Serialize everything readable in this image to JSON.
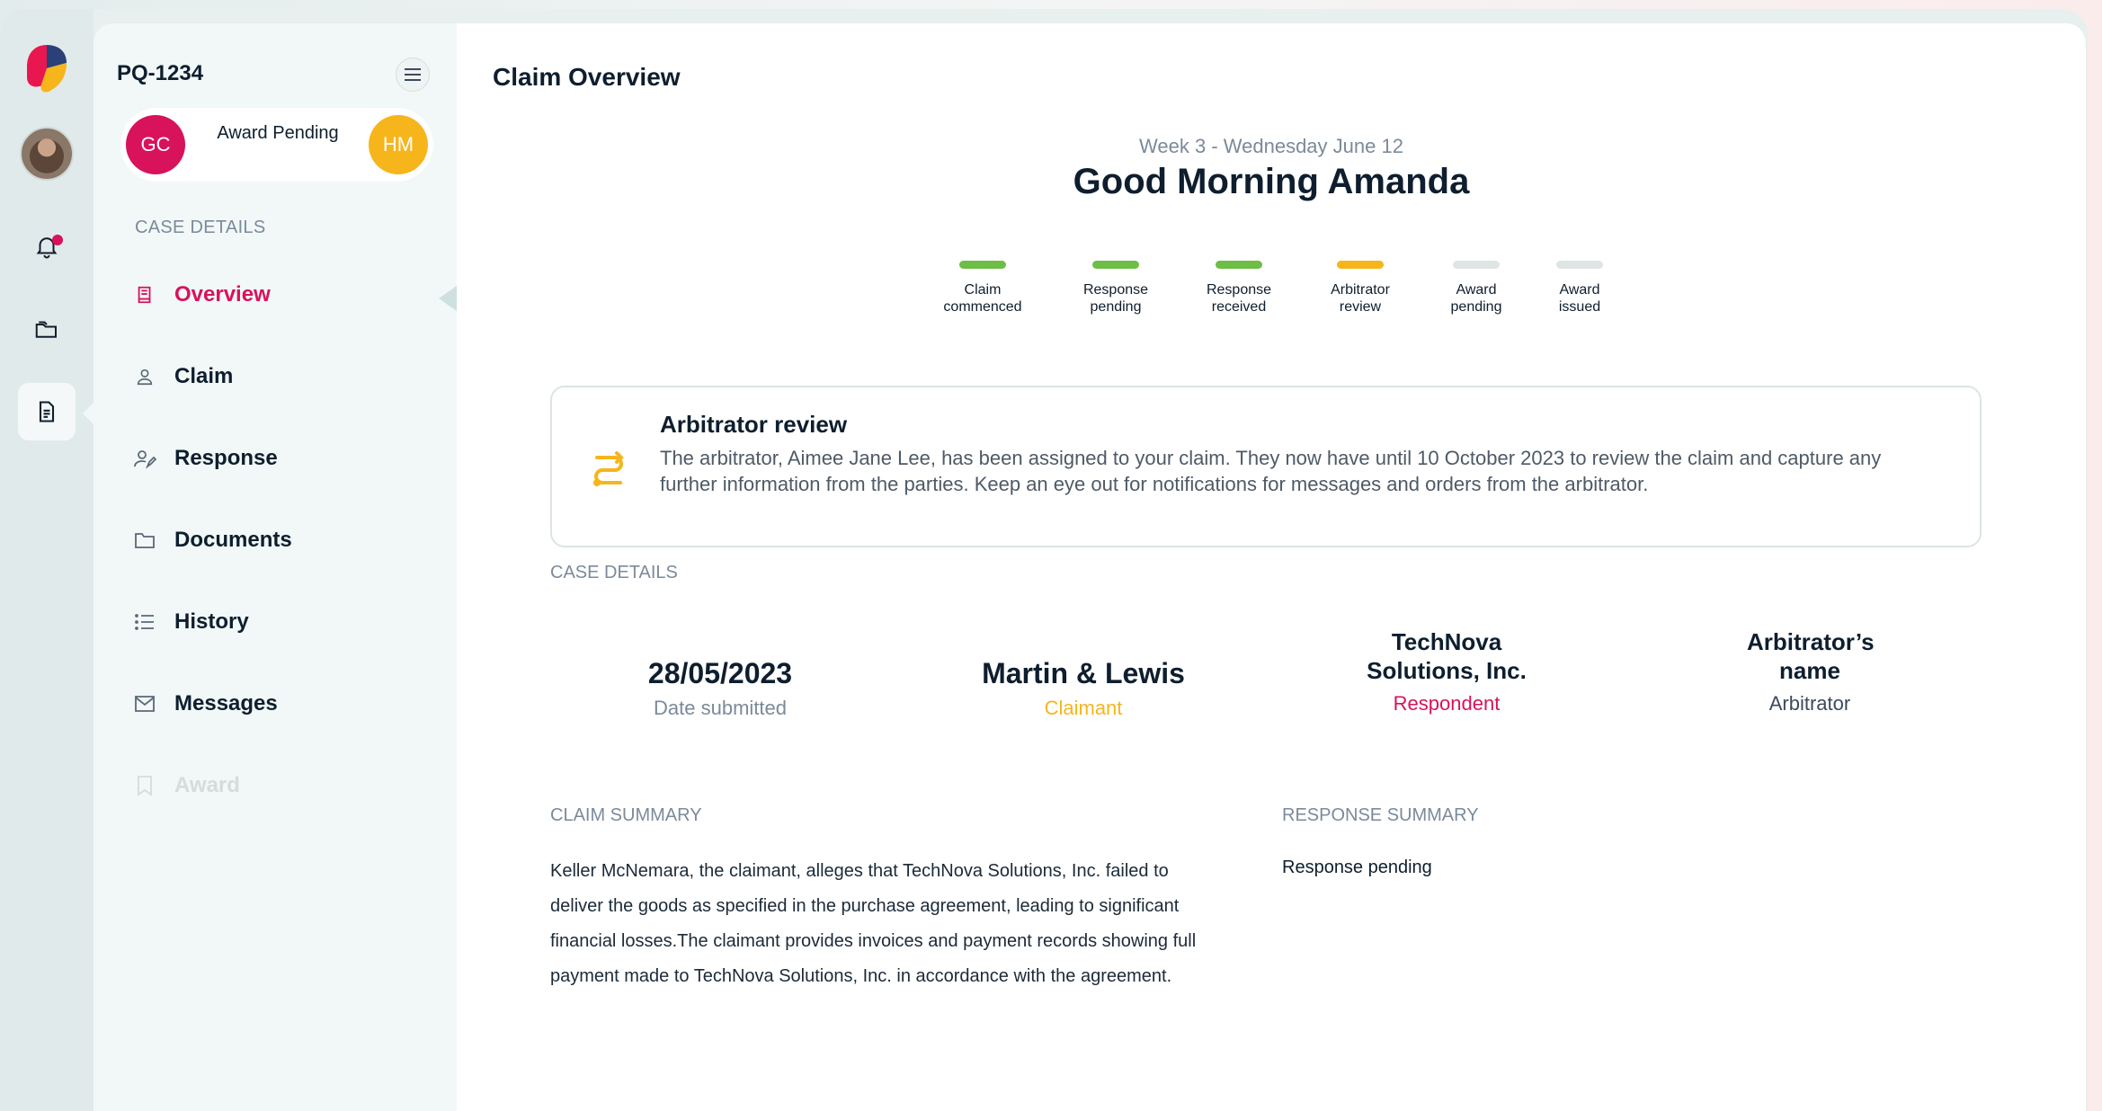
{
  "sidebar": {
    "case_id": "PQ-1234",
    "status": {
      "left_initials": "GC",
      "label": "Award Pending",
      "right_initials": "HM"
    },
    "section_label": "CASE DETAILS",
    "items": [
      {
        "label": "Overview",
        "icon": "book-icon",
        "state": "active"
      },
      {
        "label": "Claim",
        "icon": "person-icon",
        "state": "normal"
      },
      {
        "label": "Response",
        "icon": "person-edit-icon",
        "state": "normal"
      },
      {
        "label": "Documents",
        "icon": "folder-icon",
        "state": "normal"
      },
      {
        "label": "History",
        "icon": "list-icon",
        "state": "normal"
      },
      {
        "label": "Messages",
        "icon": "mail-icon",
        "state": "normal"
      },
      {
        "label": "Award",
        "icon": "bookmark-icon",
        "state": "disabled"
      }
    ]
  },
  "main": {
    "title": "Claim Overview",
    "week": "Week 3 - Wednesday June 12",
    "greeting": "Good Morning Amanda",
    "steps": [
      {
        "label": "Claim commenced",
        "line1": "Claim",
        "line2": "commenced",
        "color": "#6dbe45"
      },
      {
        "label": "Response pending",
        "line1": "Response",
        "line2": "pending",
        "color": "#6dbe45"
      },
      {
        "label": "Response received",
        "line1": "Response",
        "line2": "received",
        "color": "#6dbe45"
      },
      {
        "label": "Arbitrator review",
        "line1": "Arbitrator",
        "line2": "review",
        "color": "#f7b51c"
      },
      {
        "label": "Award pending",
        "line1": "Award",
        "line2": "pending",
        "color": "#dfe5e5"
      },
      {
        "label": "Award issued",
        "line1": "Award",
        "line2": "issued",
        "color": "#dfe5e5"
      }
    ],
    "alert": {
      "title": "Arbitrator review",
      "body": "The arbitrator, Aimee Jane Lee, has been assigned to your claim. They now have until 10 October 2023 to review the claim and capture any further information from the parties. Keep an eye out for notifications for messages and orders from the arbitrator."
    },
    "case_details_label": "CASE DETAILS",
    "details": [
      {
        "value": "28/05/2023",
        "label": "Date submitted",
        "label_color": "#7b8a9a"
      },
      {
        "value": "Martin & Lewis",
        "label": "Claimant",
        "label_color": "#f7b51c"
      },
      {
        "value": "TechNova Solutions, Inc.",
        "label": "Respondent",
        "label_color": "#d8125b"
      },
      {
        "value": "Arbitrator’s name",
        "label": "Arbitrator",
        "label_color": "#3c4a5a"
      }
    ],
    "claim_summary_label": "CLAIM SUMMARY",
    "claim_summary": "Keller McNemara, the claimant, alleges that TechNova Solutions, Inc. failed to deliver the goods as specified in the purchase agreement, leading to significant financial losses.The claimant provides invoices and payment records showing full payment made to TechNova Solutions, Inc. in accordance with the agreement.",
    "response_summary_label": "RESPONSE SUMMARY",
    "response_summary": "Response pending"
  },
  "colors": {
    "accent": "#d8125b",
    "warning": "#f7b51c",
    "success": "#6dbe45"
  }
}
